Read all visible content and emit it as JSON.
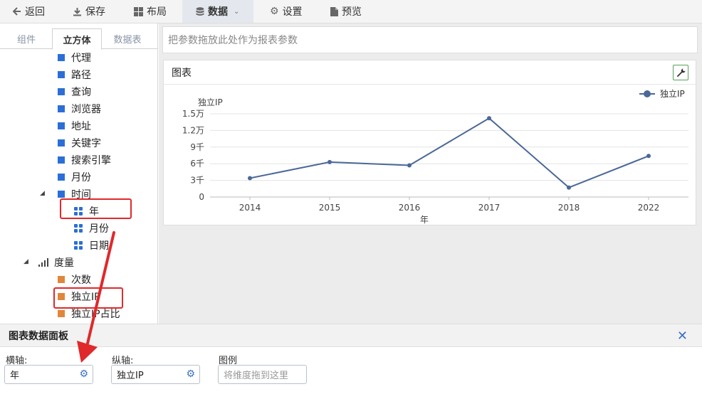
{
  "toolbar": {
    "back": "返回",
    "save": "保存",
    "layout": "布局",
    "data": "数据",
    "settings": "设置",
    "preview": "预览"
  },
  "left_tabs": [
    "组件",
    "立方体",
    "数据表"
  ],
  "tree": {
    "dimensions": [
      "代理",
      "路径",
      "查询",
      "浏览器",
      "地址",
      "关键字",
      "搜索引擎",
      "月份"
    ],
    "time_node": "时间",
    "time_children": [
      "年",
      "月份",
      "日期"
    ],
    "measure_node": "度量",
    "measures": [
      "次数",
      "独立IP",
      "独立IP占比"
    ]
  },
  "param_bar_placeholder": "把参数拖放此处作为报表参数",
  "chart_panel_title": "图表",
  "chart_data": {
    "type": "line",
    "ylabel": "独立IP",
    "xlabel": "年",
    "categories": [
      "2014",
      "2015",
      "2016",
      "2017",
      "2018",
      "2022"
    ],
    "series": [
      {
        "name": "独立IP",
        "values": [
          3400,
          6300,
          5700,
          14200,
          1700,
          7400
        ]
      }
    ],
    "yticks": [
      {
        "v": 0,
        "label": "0"
      },
      {
        "v": 3000,
        "label": "3千"
      },
      {
        "v": 6000,
        "label": "6千"
      },
      {
        "v": 9000,
        "label": "9千"
      },
      {
        "v": 12000,
        "label": "1.2万"
      },
      {
        "v": 15000,
        "label": "1.5万"
      }
    ],
    "ylim": [
      0,
      15000
    ],
    "legend_position": "top-right",
    "color": "#4a6898"
  },
  "data_panel": {
    "title": "图表数据面板",
    "x_axis_label": "横轴:",
    "x_axis_value": "年",
    "y_axis_label": "纵轴:",
    "y_axis_value": "独立IP",
    "legend_label": "图例",
    "legend_placeholder": "将维度拖到这里"
  }
}
